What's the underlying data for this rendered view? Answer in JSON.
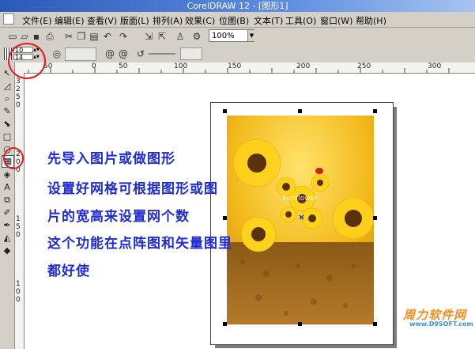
{
  "window": {
    "title": "CorelDRAW 12 - [图形1]"
  },
  "menu": {
    "items": [
      {
        "label": "文件(E)"
      },
      {
        "label": "编辑(E)"
      },
      {
        "label": "查看(V)"
      },
      {
        "label": "版面(L)"
      },
      {
        "label": "排列(A)"
      },
      {
        "label": "效果(C)"
      },
      {
        "label": "位图(B)"
      },
      {
        "label": "文本(T)"
      },
      {
        "label": "工具(O)"
      },
      {
        "label": "窗口(W)"
      },
      {
        "label": "帮助(H)"
      }
    ]
  },
  "toolbar": {
    "zoom_value": "100%"
  },
  "property_bar": {
    "grid_columns": "10",
    "grid_rows": "14"
  },
  "ruler": {
    "top_labels": [
      "50",
      "0",
      "50",
      "100",
      "150",
      "200",
      "250",
      "300"
    ],
    "left_labels": [
      "3",
      "2",
      "5",
      "0",
      "2",
      "0",
      "0",
      "1",
      "5",
      "0",
      "1",
      "0",
      "0"
    ]
  },
  "annotations": {
    "line1": "先导入图片或做图形",
    "line2": "设置好网格可根据图形或图",
    "line3": "片的宽高来设置网个数",
    "line4": "这个功能在点阵图和矢量图里",
    "line5": "都好使"
  },
  "watermark": {
    "brand": "周力软件网",
    "url": "www.D9SOFT.com"
  },
  "photo": {
    "small_text": "Sunflower"
  },
  "colors": {
    "annotation": "#1f2bd6",
    "highlight_circle": "#e31b1b",
    "titlebar": "#2a5ab8"
  }
}
